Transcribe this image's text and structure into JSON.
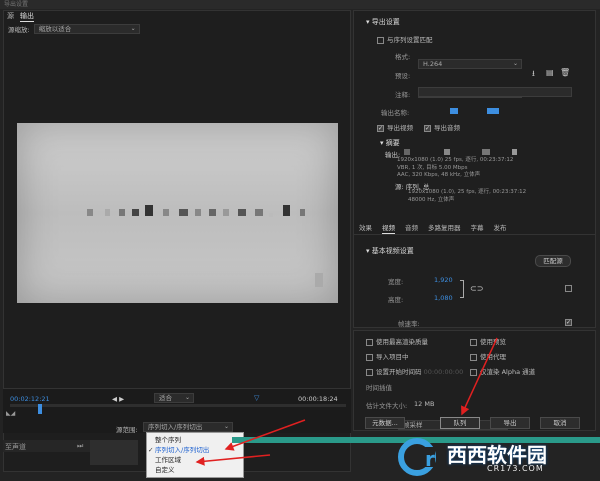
{
  "title_bar": {
    "title": "导出设置"
  },
  "left_tabs": [
    "源",
    "输出"
  ],
  "source_scale": {
    "label": "源缩放:",
    "value": "缩放以适合"
  },
  "timecode_left": "00:02:12:21",
  "zoom_value": "适合",
  "timecode_right": "00:00:18:24",
  "source_range": {
    "label": "源范围:",
    "value": "序列切入/序列切出"
  },
  "range_menu": {
    "items": [
      "整个序列",
      "序列切入/序列切出",
      "工作区域",
      "自定义"
    ],
    "selected_index": 1
  },
  "timeline_misc": {
    "label": "至声道"
  },
  "export_settings": {
    "header": "导出设置",
    "match_sequence": "与序列设置匹配",
    "format_label": "格式:",
    "format_value": "H.264",
    "preset_label": "预设:",
    "preset_value": "S",
    "comments_label": "注释:",
    "output_name_label": "输出名称:",
    "export_video": "导出视频",
    "export_audio": "导出音频",
    "summary": {
      "header": "摘要",
      "output_label": "输出:",
      "output_lines": [
        "1920x1080 (1.0)  25 fps, 逐行, 00:23:37:12",
        "VBR, 1 次, 目标 5.00 Mbps",
        "AAC, 320 Kbps, 48 kHz, 立体声"
      ],
      "source_label": "源:",
      "source_name": "序列, 总",
      "source_lines": [
        "1920x1080 (1.0), 25 fps, 逐行, 00:23:37:12",
        "48000 Hz, 立体声"
      ]
    }
  },
  "right_tabs": [
    "效果",
    "视频",
    "音频",
    "多路复用器",
    "字幕",
    "发布"
  ],
  "active_right_tab": "视频",
  "basic_video": {
    "header": "基本视频设置",
    "match_source": "匹配源",
    "width_label": "宽度:",
    "width_value": "1,920",
    "height_label": "高度:",
    "height_value": "1,080",
    "frame_rate_label": "帧速率:"
  },
  "options": {
    "max_render_quality": "使用最高渲染质量",
    "use_previews": "使用预览",
    "import_into_project": "导入项目中",
    "use_proxies": "使用代理",
    "set_start_timecode": "设置开始时间码",
    "timecode_placeholder": "00:00:00:00",
    "render_alpha": "仅渲染 Alpha 通道",
    "time_interpolation_label": "时间插值",
    "time_interpolation_value": "帧采样",
    "estimated_size_label": "估计文件大小:",
    "estimated_size_value": "12 MB"
  },
  "buttons": {
    "metadata": "元数据...",
    "queue": "队列",
    "export": "导出",
    "cancel": "取消"
  },
  "watermark": {
    "logo_text": "西西软件园",
    "url": "CR173.COM"
  },
  "colors": {
    "accent_blue": "#3d8ee0",
    "arrow_red": "#e02020",
    "teal": "#2a9a8a"
  }
}
